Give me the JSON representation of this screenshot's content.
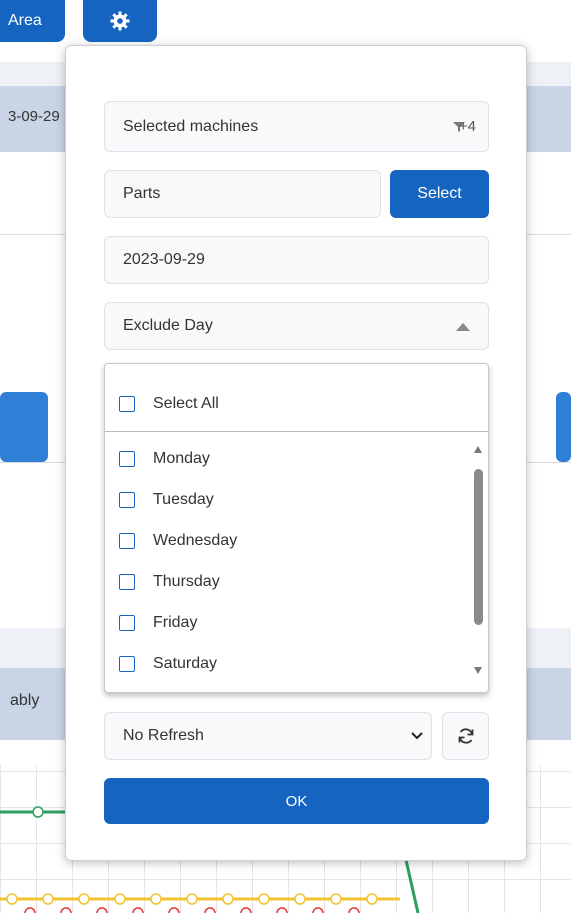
{
  "background": {
    "area_button_label": "Area",
    "date_text": "3-09-29",
    "side_label": "ably"
  },
  "modal": {
    "machines": {
      "label": "Selected machines",
      "count": "+4"
    },
    "parts": {
      "value": "Parts",
      "select_label": "Select"
    },
    "date": {
      "value": "2023-09-29"
    },
    "exclude_day": {
      "label": "Exclude Day",
      "select_all": "Select All",
      "days": [
        "Monday",
        "Tuesday",
        "Wednesday",
        "Thursday",
        "Friday",
        "Saturday"
      ]
    },
    "refresh": {
      "selected": "No Refresh"
    },
    "ok_label": "OK"
  },
  "colors": {
    "accent": "#1565c0",
    "field_bg": "#f8f9fa",
    "band": "#c9d5e6"
  },
  "icons": [
    "gear-icon",
    "filter-icon",
    "chevron-up-icon",
    "chevron-down-icon",
    "refresh-icon"
  ]
}
